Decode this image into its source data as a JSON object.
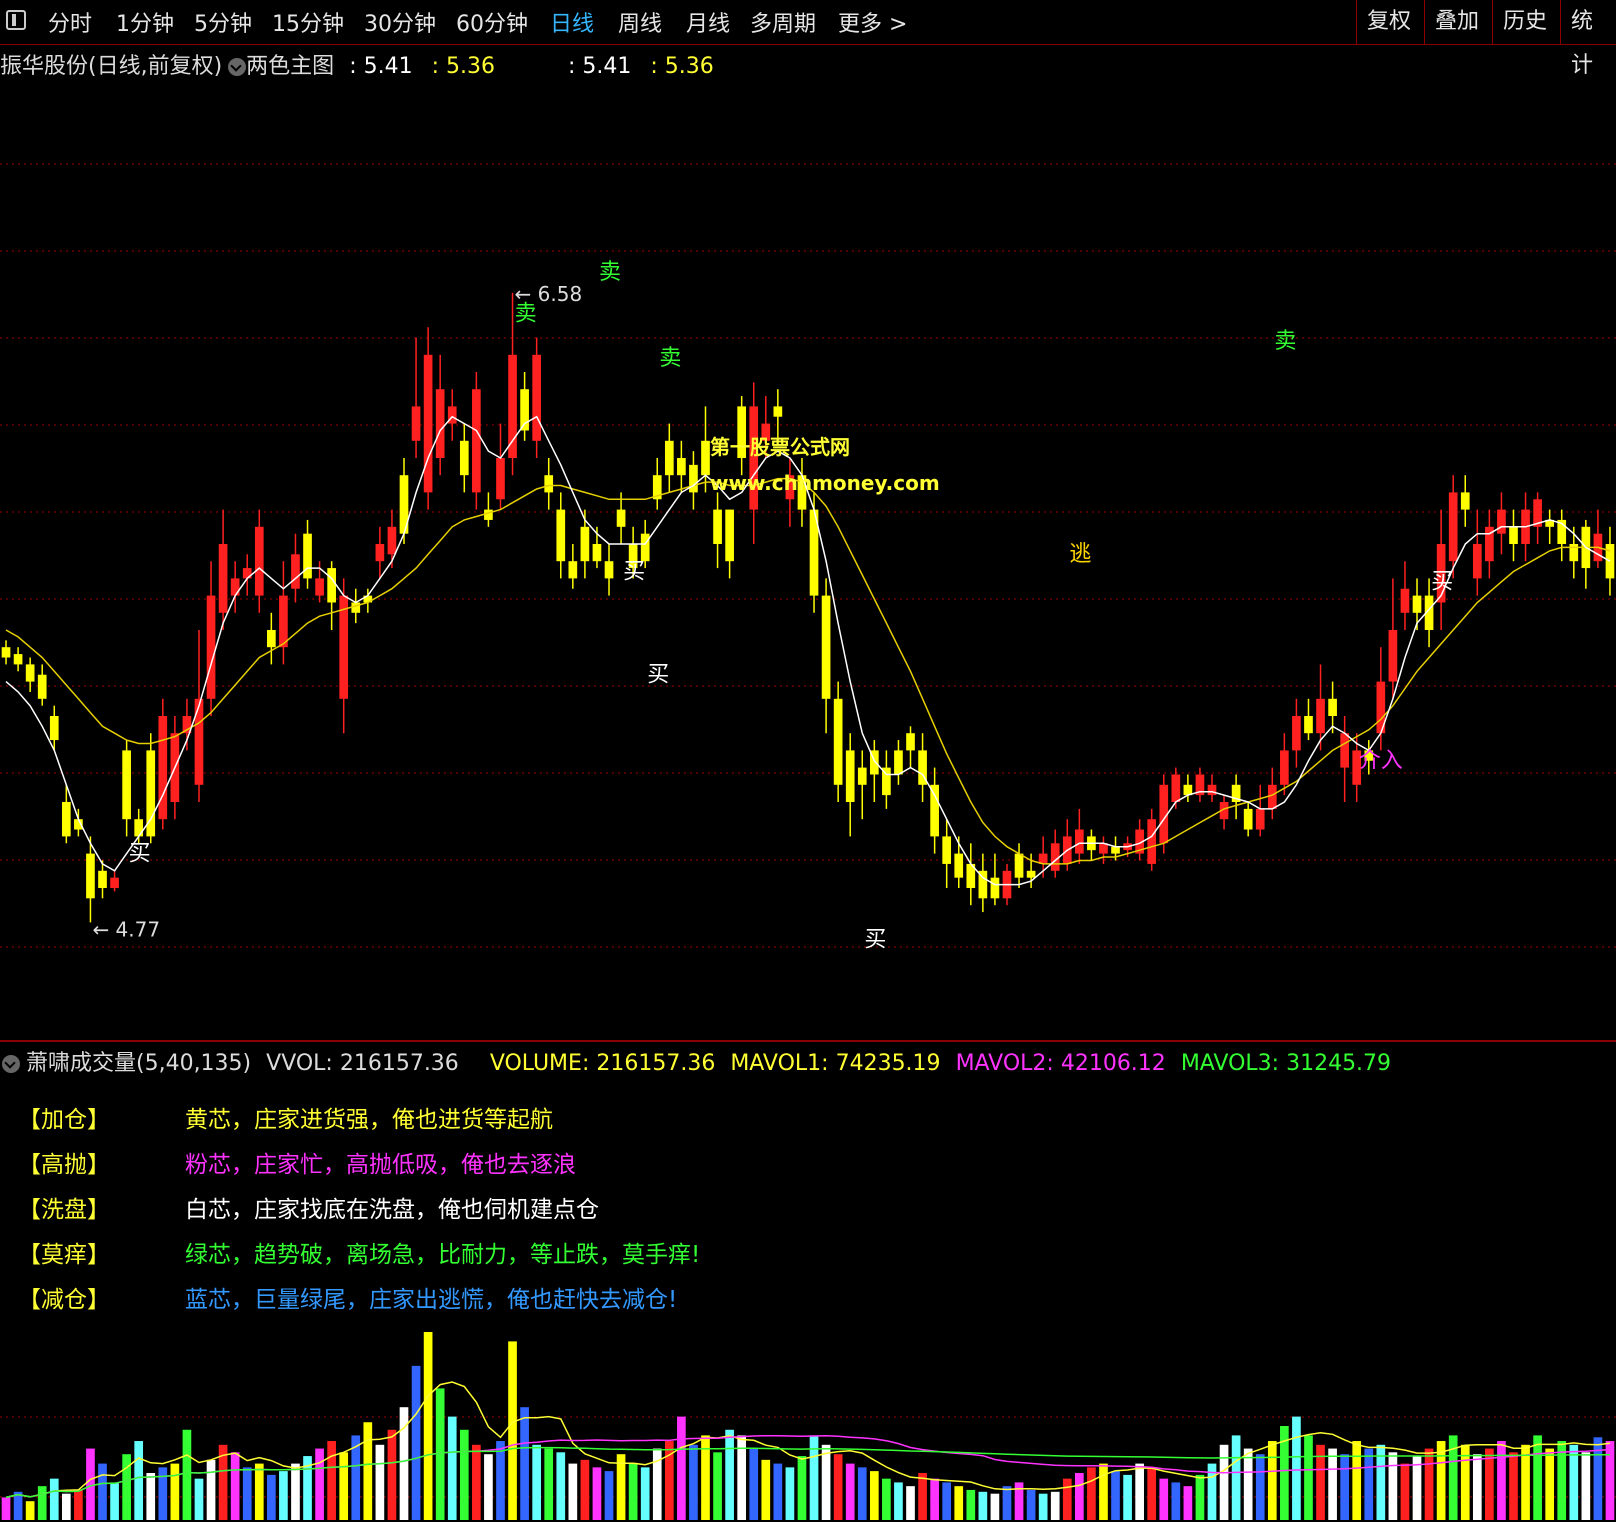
{
  "toolbar": {
    "periods": [
      "分时",
      "1分钟",
      "5分钟",
      "15分钟",
      "30分钟",
      "60分钟",
      "日线",
      "周线",
      "月线",
      "多周期",
      "更多 >"
    ],
    "active_period": "日线",
    "right_buttons": [
      "复权",
      "叠加",
      "历史",
      "统计"
    ]
  },
  "main_header": {
    "stock": "振华股份(日线,前复权)",
    "indicator": "两色主图",
    "v1": ": 5.41",
    "v2": ": 5.36",
    "v3": ": 5.41",
    "v4": ": 5.36"
  },
  "vol_header": {
    "name": "萧啸成交量(5,40,135)",
    "vvol": "VVOL: 216157.36",
    "volume": "VOLUME: 216157.36",
    "mavol1": "MAVOL1: 74235.19",
    "mavol2": "MAVOL2: 42106.12",
    "mavol3": "MAVOL3: 31245.79"
  },
  "legend": [
    {
      "tag": "【加仓】",
      "text": "黄芯，庄家进货强，俺也进货等起航",
      "color": "#ffff33"
    },
    {
      "tag": "【高抛】",
      "text": "粉芯，庄家忙，高抛低吸，俺也去逐浪",
      "color": "#ff33ff"
    },
    {
      "tag": "【洗盘】",
      "text": "白芯，庄家找底在洗盘，俺也伺机建点仓",
      "color": "#ffffff"
    },
    {
      "tag": "【莫痒】",
      "text": "绿芯，趋势破，离场急，比耐力，等止跌，莫手痒!",
      "color": "#33ff33"
    },
    {
      "tag": "【减仓】",
      "text": "蓝芯，巨量绿尾，庄家出逃慌，俺也赶快去减仓!",
      "color": "#3399ff"
    }
  ],
  "watermark": {
    "line1": "第一股票公式网",
    "line2": "www.chnmoney.com"
  },
  "colors": {
    "up": "#ff2020",
    "down": "#ffff00",
    "peach": "#ffb070",
    "green": "#00cc00",
    "ma_white": "#ffffff",
    "ma_yellow": "#e6d000",
    "grid": "#a00000"
  },
  "chart_data": {
    "type": "candlestick",
    "high_label": "6.58",
    "low_label": "4.77",
    "ylim": [
      4.6,
      7.1
    ],
    "xlim": [
      0,
      134
    ],
    "candles": [
      [
        0,
        5.55,
        5.52,
        5.57,
        5.5
      ],
      [
        1,
        5.53,
        5.5,
        5.55,
        5.48
      ],
      [
        2,
        5.5,
        5.45,
        5.52,
        5.42
      ],
      [
        3,
        5.47,
        5.4,
        5.5,
        5.38
      ],
      [
        4,
        5.35,
        5.28,
        5.38,
        5.25
      ],
      [
        5,
        5.1,
        5.0,
        5.15,
        4.98
      ],
      [
        6,
        5.05,
        5.02,
        5.08,
        5.0
      ],
      [
        7,
        4.95,
        4.82,
        5.0,
        4.75
      ],
      [
        8,
        4.9,
        4.85,
        4.93,
        4.82
      ],
      [
        9,
        4.85,
        4.88,
        4.9,
        4.84
      ],
      [
        10,
        5.25,
        5.05,
        5.28,
        5.0
      ],
      [
        11,
        5.05,
        5.0,
        5.08,
        4.98
      ],
      [
        12,
        5.25,
        5.0,
        5.3,
        4.98
      ],
      [
        13,
        5.05,
        5.35,
        5.4,
        5.02
      ],
      [
        14,
        5.1,
        5.3,
        5.35,
        5.05
      ],
      [
        15,
        5.3,
        5.35,
        5.4,
        5.25
      ],
      [
        16,
        5.15,
        5.4,
        5.6,
        5.1
      ],
      [
        17,
        5.4,
        5.7,
        5.8,
        5.35
      ],
      [
        18,
        5.65,
        5.85,
        5.95,
        5.6
      ],
      [
        19,
        5.7,
        5.75,
        5.8,
        5.65
      ],
      [
        20,
        5.75,
        5.78,
        5.82,
        5.7
      ],
      [
        21,
        5.7,
        5.9,
        5.95,
        5.65
      ],
      [
        22,
        5.6,
        5.55,
        5.65,
        5.5
      ],
      [
        23,
        5.55,
        5.7,
        5.8,
        5.5
      ],
      [
        24,
        5.72,
        5.82,
        5.88,
        5.68
      ],
      [
        25,
        5.88,
        5.75,
        5.92,
        5.72
      ],
      [
        26,
        5.7,
        5.75,
        5.8,
        5.68
      ],
      [
        27,
        5.78,
        5.68,
        5.8,
        5.6
      ],
      [
        28,
        5.4,
        5.7,
        5.75,
        5.3
      ],
      [
        29,
        5.68,
        5.65,
        5.72,
        5.62
      ],
      [
        30,
        5.7,
        5.68,
        5.72,
        5.65
      ],
      [
        31,
        5.8,
        5.85,
        5.9,
        5.75
      ],
      [
        32,
        5.82,
        5.9,
        5.95,
        5.78
      ],
      [
        33,
        6.05,
        5.88,
        6.1,
        5.85
      ],
      [
        34,
        6.15,
        6.25,
        6.45,
        6.1
      ],
      [
        35,
        6.0,
        6.4,
        6.48,
        5.95
      ],
      [
        36,
        6.1,
        6.3,
        6.4,
        6.05
      ],
      [
        37,
        6.2,
        6.25,
        6.3,
        6.15
      ],
      [
        38,
        6.15,
        6.05,
        6.2,
        6.0
      ],
      [
        39,
        6.0,
        6.3,
        6.35,
        5.95
      ],
      [
        40,
        5.95,
        5.92,
        6.0,
        5.9
      ],
      [
        41,
        5.98,
        6.1,
        6.2,
        5.95
      ],
      [
        42,
        6.1,
        6.4,
        6.58,
        6.05
      ],
      [
        43,
        6.3,
        6.18,
        6.35,
        6.15
      ],
      [
        44,
        6.15,
        6.4,
        6.45,
        6.1
      ],
      [
        45,
        6.05,
        6.0,
        6.1,
        5.95
      ],
      [
        46,
        5.95,
        5.8,
        6.0,
        5.75
      ],
      [
        47,
        5.8,
        5.75,
        5.85,
        5.72
      ],
      [
        48,
        5.9,
        5.8,
        5.95,
        5.75
      ],
      [
        49,
        5.85,
        5.8,
        5.9,
        5.78
      ],
      [
        50,
        5.8,
        5.75,
        5.85,
        5.7
      ],
      [
        51,
        5.95,
        5.9,
        6.0,
        5.85
      ],
      [
        52,
        5.85,
        5.78,
        5.9,
        5.75
      ],
      [
        53,
        5.88,
        5.8,
        5.92,
        5.78
      ],
      [
        54,
        6.05,
        5.98,
        6.1,
        5.95
      ],
      [
        55,
        6.15,
        6.05,
        6.2,
        6.0
      ],
      [
        56,
        6.1,
        6.05,
        6.15,
        6.0
      ],
      [
        57,
        6.08,
        6.0,
        6.12,
        5.95
      ],
      [
        58,
        6.15,
        6.05,
        6.25,
        6.0
      ],
      [
        59,
        5.95,
        5.85,
        6.0,
        5.78
      ],
      [
        60,
        5.95,
        5.8,
        5.95,
        5.75
      ],
      [
        61,
        6.25,
        6.1,
        6.28,
        6.05
      ],
      [
        62,
        5.95,
        6.25,
        6.32,
        5.85
      ],
      [
        63,
        6.15,
        6.2,
        6.28,
        6.1
      ],
      [
        64,
        6.25,
        6.22,
        6.3,
        6.15
      ],
      [
        65,
        5.98,
        6.05,
        6.1,
        5.9
      ],
      [
        66,
        6.05,
        5.95,
        6.1,
        5.9
      ],
      [
        67,
        5.95,
        5.7,
        6.0,
        5.65
      ],
      [
        68,
        5.7,
        5.4,
        5.75,
        5.3
      ],
      [
        69,
        5.4,
        5.15,
        5.45,
        5.1
      ],
      [
        70,
        5.25,
        5.1,
        5.3,
        5.0
      ],
      [
        71,
        5.2,
        5.15,
        5.25,
        5.05
      ],
      [
        72,
        5.25,
        5.18,
        5.28,
        5.1
      ],
      [
        73,
        5.2,
        5.12,
        5.25,
        5.08
      ],
      [
        74,
        5.25,
        5.18,
        5.28,
        5.15
      ],
      [
        75,
        5.3,
        5.25,
        5.32,
        5.2
      ],
      [
        76,
        5.25,
        5.15,
        5.3,
        5.1
      ],
      [
        77,
        5.15,
        5.0,
        5.2,
        4.95
      ],
      [
        78,
        5.0,
        4.92,
        5.05,
        4.85
      ],
      [
        79,
        4.95,
        4.88,
        5.0,
        4.85
      ],
      [
        80,
        4.92,
        4.85,
        4.98,
        4.8
      ],
      [
        81,
        4.9,
        4.82,
        4.95,
        4.78
      ],
      [
        82,
        4.88,
        4.82,
        4.95,
        4.8
      ],
      [
        83,
        4.82,
        4.9,
        4.92,
        4.8
      ],
      [
        84,
        4.95,
        4.88,
        4.98,
        4.85
      ],
      [
        85,
        4.9,
        4.88,
        4.95,
        4.85
      ],
      [
        86,
        4.92,
        4.95,
        5.0,
        4.88
      ],
      [
        87,
        4.9,
        4.98,
        5.02,
        4.88
      ],
      [
        88,
        4.92,
        5.0,
        5.05,
        4.9
      ],
      [
        89,
        4.95,
        5.02,
        5.08,
        4.92
      ],
      [
        90,
        5.0,
        4.96,
        5.02,
        4.93
      ],
      [
        91,
        4.95,
        4.98,
        5.0,
        4.92
      ],
      [
        92,
        4.97,
        4.95,
        5.0,
        4.93
      ],
      [
        93,
        4.96,
        4.98,
        5.0,
        4.94
      ],
      [
        94,
        4.95,
        5.02,
        5.05,
        4.93
      ],
      [
        95,
        4.92,
        5.05,
        5.08,
        4.9
      ],
      [
        96,
        4.98,
        5.15,
        5.18,
        4.95
      ],
      [
        97,
        5.1,
        5.18,
        5.2,
        5.08
      ],
      [
        98,
        5.15,
        5.12,
        5.18,
        5.1
      ],
      [
        99,
        5.12,
        5.18,
        5.2,
        5.1
      ],
      [
        100,
        5.12,
        5.15,
        5.18,
        5.1
      ],
      [
        101,
        5.05,
        5.1,
        5.12,
        5.02
      ],
      [
        102,
        5.15,
        5.1,
        5.18,
        5.05
      ],
      [
        103,
        5.08,
        5.02,
        5.1,
        5.0
      ],
      [
        104,
        5.02,
        5.08,
        5.15,
        5.0
      ],
      [
        105,
        5.08,
        5.15,
        5.2,
        5.05
      ],
      [
        106,
        5.15,
        5.25,
        5.3,
        5.12
      ],
      [
        107,
        5.25,
        5.35,
        5.4,
        5.2
      ],
      [
        108,
        5.35,
        5.3,
        5.4,
        5.28
      ],
      [
        109,
        5.3,
        5.4,
        5.5,
        5.25
      ],
      [
        110,
        5.4,
        5.35,
        5.45,
        5.3
      ],
      [
        111,
        5.2,
        5.3,
        5.35,
        5.1
      ],
      [
        112,
        5.15,
        5.25,
        5.3,
        5.1
      ],
      [
        113,
        5.25,
        5.22,
        5.28,
        5.18
      ],
      [
        114,
        5.3,
        5.45,
        5.55,
        5.25
      ],
      [
        115,
        5.45,
        5.6,
        5.75,
        5.4
      ],
      [
        116,
        5.65,
        5.72,
        5.8,
        5.6
      ],
      [
        117,
        5.7,
        5.65,
        5.75,
        5.6
      ],
      [
        118,
        5.7,
        5.6,
        5.75,
        5.55
      ],
      [
        119,
        5.68,
        5.85,
        5.95,
        5.6
      ],
      [
        120,
        5.8,
        6.0,
        6.05,
        5.75
      ],
      [
        121,
        6.0,
        5.95,
        6.05,
        5.9
      ],
      [
        122,
        5.75,
        5.85,
        5.95,
        5.7
      ],
      [
        123,
        5.8,
        5.9,
        5.95,
        5.75
      ],
      [
        124,
        5.88,
        5.95,
        6.0,
        5.82
      ],
      [
        125,
        5.9,
        5.85,
        5.95,
        5.8
      ],
      [
        126,
        5.85,
        5.95,
        6.0,
        5.8
      ],
      [
        127,
        5.9,
        5.98,
        6.0,
        5.85
      ],
      [
        128,
        5.92,
        5.9,
        5.95,
        5.85
      ],
      [
        129,
        5.92,
        5.85,
        5.95,
        5.8
      ],
      [
        130,
        5.85,
        5.8,
        5.9,
        5.75
      ],
      [
        131,
        5.9,
        5.78,
        5.92,
        5.72
      ],
      [
        132,
        5.8,
        5.88,
        5.95,
        5.78
      ],
      [
        133,
        5.85,
        5.75,
        5.9,
        5.7
      ]
    ],
    "ma_short": [
      5.45,
      5.42,
      5.38,
      5.32,
      5.25,
      5.15,
      5.05,
      4.98,
      4.92,
      4.9,
      4.95,
      5.0,
      5.05,
      5.12,
      5.2,
      5.28,
      5.38,
      5.5,
      5.62,
      5.7,
      5.75,
      5.78,
      5.75,
      5.72,
      5.75,
      5.78,
      5.78,
      5.75,
      5.7,
      5.68,
      5.7,
      5.75,
      5.8,
      5.88,
      6.0,
      6.1,
      6.18,
      6.22,
      6.2,
      6.18,
      6.12,
      6.1,
      6.15,
      6.2,
      6.22,
      6.15,
      6.08,
      6.0,
      5.92,
      5.88,
      5.85,
      5.85,
      5.85,
      5.85,
      5.9,
      5.95,
      6.0,
      6.02,
      6.05,
      6.02,
      5.98,
      6.0,
      6.05,
      6.1,
      6.12,
      6.1,
      6.05,
      5.95,
      5.8,
      5.62,
      5.45,
      5.3,
      5.22,
      5.18,
      5.18,
      5.2,
      5.18,
      5.12,
      5.05,
      4.98,
      4.92,
      4.88,
      4.86,
      4.86,
      4.86,
      4.87,
      4.9,
      4.93,
      4.96,
      4.98,
      4.98,
      4.98,
      4.97,
      4.97,
      4.98,
      5.0,
      5.05,
      5.1,
      5.12,
      5.13,
      5.13,
      5.12,
      5.11,
      5.1,
      5.08,
      5.08,
      5.1,
      5.15,
      5.22,
      5.28,
      5.32,
      5.3,
      5.27,
      5.25,
      5.3,
      5.4,
      5.52,
      5.62,
      5.66,
      5.7,
      5.78,
      5.85,
      5.88,
      5.88,
      5.9,
      5.9,
      5.9,
      5.91,
      5.92,
      5.91,
      5.88,
      5.84,
      5.82,
      5.8
    ],
    "ma_long": [
      5.6,
      5.58,
      5.55,
      5.52,
      5.48,
      5.44,
      5.4,
      5.36,
      5.32,
      5.3,
      5.28,
      5.27,
      5.27,
      5.28,
      5.29,
      5.31,
      5.33,
      5.36,
      5.4,
      5.44,
      5.48,
      5.52,
      5.54,
      5.56,
      5.59,
      5.62,
      5.64,
      5.65,
      5.66,
      5.67,
      5.68,
      5.7,
      5.72,
      5.75,
      5.78,
      5.82,
      5.86,
      5.9,
      5.92,
      5.93,
      5.94,
      5.95,
      5.97,
      5.99,
      6.01,
      6.02,
      6.02,
      6.01,
      6.0,
      5.99,
      5.98,
      5.98,
      5.98,
      5.98,
      5.99,
      6.0,
      6.01,
      6.02,
      6.03,
      6.03,
      6.02,
      6.02,
      6.02,
      6.03,
      6.04,
      6.04,
      6.03,
      6.0,
      5.96,
      5.9,
      5.83,
      5.76,
      5.69,
      5.62,
      5.55,
      5.48,
      5.4,
      5.32,
      5.24,
      5.17,
      5.1,
      5.04,
      5.0,
      4.97,
      4.95,
      4.93,
      4.92,
      4.92,
      4.92,
      4.93,
      4.93,
      4.94,
      4.94,
      4.95,
      4.96,
      4.97,
      4.98,
      5.0,
      5.02,
      5.04,
      5.06,
      5.08,
      5.09,
      5.1,
      5.11,
      5.12,
      5.14,
      5.16,
      5.19,
      5.22,
      5.25,
      5.27,
      5.29,
      5.31,
      5.34,
      5.38,
      5.43,
      5.48,
      5.52,
      5.56,
      5.6,
      5.64,
      5.68,
      5.71,
      5.74,
      5.77,
      5.79,
      5.81,
      5.83,
      5.84,
      5.84,
      5.84,
      5.84,
      5.83
    ],
    "signals": [
      {
        "i": 11,
        "text": "买",
        "price": 4.93,
        "color": "#ffffff"
      },
      {
        "i": 43,
        "text": "卖",
        "price": 6.5,
        "color": "#33ff33"
      },
      {
        "i": 50,
        "text": "卖",
        "price": 6.62,
        "color": "#33ff33"
      },
      {
        "i": 55,
        "text": "卖",
        "price": 6.37,
        "color": "#33ff33"
      },
      {
        "i": 52,
        "text": "买",
        "price": 5.75,
        "color": "#ffffff"
      },
      {
        "i": 54,
        "text": "买",
        "price": 5.45,
        "color": "#ffffff"
      },
      {
        "i": 72,
        "text": "买",
        "price": 4.68,
        "color": "#ffffff"
      },
      {
        "i": 89,
        "text": "逃",
        "price": 5.8,
        "color": "#ffd700"
      },
      {
        "i": 106,
        "text": "卖",
        "price": 6.42,
        "color": "#33ff33"
      },
      {
        "i": 119,
        "text": "买",
        "price": 5.72,
        "color": "#ffffff"
      },
      {
        "i": 113,
        "text": "介入",
        "price": 5.2,
        "color": "#ff33ff"
      }
    ],
    "volumes": [
      0.12,
      0.15,
      0.1,
      0.18,
      0.22,
      0.14,
      0.16,
      0.38,
      0.3,
      0.2,
      0.35,
      0.42,
      0.25,
      0.28,
      0.3,
      0.48,
      0.22,
      0.32,
      0.4,
      0.36,
      0.28,
      0.3,
      0.24,
      0.26,
      0.3,
      0.34,
      0.38,
      0.42,
      0.36,
      0.45,
      0.52,
      0.4,
      0.48,
      0.6,
      0.82,
      1.0,
      0.7,
      0.55,
      0.48,
      0.4,
      0.35,
      0.42,
      0.95,
      0.6,
      0.4,
      0.38,
      0.36,
      0.3,
      0.32,
      0.28,
      0.26,
      0.35,
      0.3,
      0.28,
      0.38,
      0.42,
      0.55,
      0.4,
      0.45,
      0.36,
      0.48,
      0.45,
      0.38,
      0.32,
      0.3,
      0.28,
      0.34,
      0.45,
      0.4,
      0.35,
      0.3,
      0.28,
      0.26,
      0.22,
      0.2,
      0.18,
      0.25,
      0.22,
      0.2,
      0.18,
      0.16,
      0.15,
      0.14,
      0.18,
      0.2,
      0.16,
      0.14,
      0.15,
      0.22,
      0.25,
      0.28,
      0.3,
      0.26,
      0.24,
      0.3,
      0.28,
      0.22,
      0.2,
      0.18,
      0.24,
      0.3,
      0.4,
      0.45,
      0.38,
      0.35,
      0.42,
      0.5,
      0.55,
      0.45,
      0.4,
      0.38,
      0.35,
      0.42,
      0.38,
      0.4,
      0.36,
      0.3,
      0.34,
      0.38,
      0.42,
      0.45,
      0.4,
      0.35,
      0.38,
      0.42,
      0.36,
      0.4,
      0.45,
      0.38,
      0.42,
      0.4,
      0.36,
      0.44,
      0.42
    ],
    "volume_ylim": [
      0,
      1.0
    ]
  }
}
